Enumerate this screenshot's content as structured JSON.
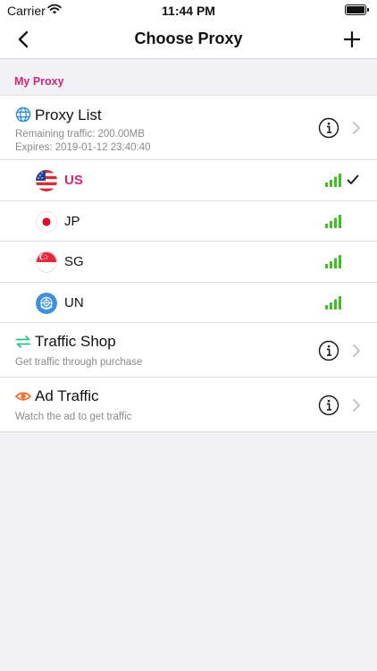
{
  "status_bar": {
    "carrier": "Carrier",
    "time": "11:44 PM"
  },
  "nav": {
    "title": "Choose Proxy"
  },
  "section": {
    "header": "My Proxy"
  },
  "proxy_list": {
    "title": "Proxy List",
    "remaining": "Remaining traffic: 200.00MB",
    "expires": "Expires: 2019-01-12 23:40:40"
  },
  "countries": [
    {
      "code": "US",
      "selected": true
    },
    {
      "code": "JP",
      "selected": false
    },
    {
      "code": "SG",
      "selected": false
    },
    {
      "code": "UN",
      "selected": false
    }
  ],
  "traffic_shop": {
    "title": "Traffic Shop",
    "subtitle": "Get traffic through purchase"
  },
  "ad_traffic": {
    "title": "Ad Traffic",
    "subtitle": "Watch the ad to get traffic"
  },
  "colors": {
    "accent": "#d0267a",
    "signal": "#3fbf24",
    "background": "#f2f2f4"
  },
  "icons": {
    "proxy_list": "globe-icon",
    "traffic_shop": "transfer-arrows-icon",
    "ad_traffic": "eye-icon",
    "info": "info-icon",
    "chevron": "chevron-right-icon"
  }
}
